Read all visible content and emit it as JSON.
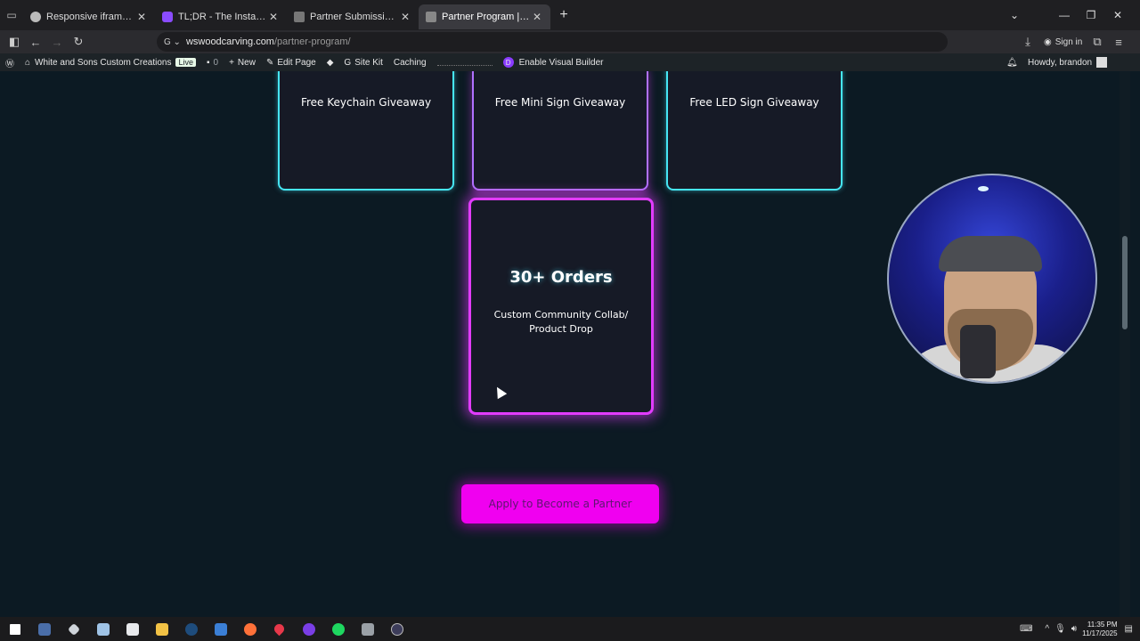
{
  "browser": {
    "tabs": [
      {
        "label": "Responsive iframe layout",
        "icon": "openai-icon",
        "active": false
      },
      {
        "label": "TL;DR - The Instant Replay for L",
        "icon": "tldr-icon",
        "active": false
      },
      {
        "label": "Partner Submission | White and",
        "icon": "wood-icon",
        "active": false
      },
      {
        "label": "Partner Program | White and Sc",
        "icon": "wood-icon",
        "active": true
      }
    ],
    "url_domain": "wswoodcarving.com",
    "url_path": "/partner-program/",
    "sign_in": "Sign in"
  },
  "wp_admin_bar": {
    "site_name": "White and Sons Custom Creations",
    "live_badge": "Live",
    "comments_count": "0",
    "new_label": "New",
    "edit_page": "Edit Page",
    "site_kit": "Site Kit",
    "caching": "Caching",
    "visual_builder": "Enable Visual Builder",
    "howdy": "Howdy, brandon"
  },
  "page": {
    "top_cards": [
      {
        "text": "Free Keychain Giveaway"
      },
      {
        "text": "Free Mini Sign Giveaway"
      },
      {
        "text": "Free LED Sign Giveaway"
      }
    ],
    "big_card": {
      "title": "30+ Orders",
      "description": "Custom Community Collab/ Product Drop"
    },
    "apply_button": "Apply to Become a Partner"
  },
  "taskbar": {
    "time": "11:35 PM",
    "date": "11/17/2025"
  },
  "colors": {
    "page_bg": "#0c1a23",
    "card_bg": "#161a26",
    "cyan_border": "#46e6f4",
    "magenta_border": "#e23cff",
    "button_bg": "#f000f0"
  }
}
